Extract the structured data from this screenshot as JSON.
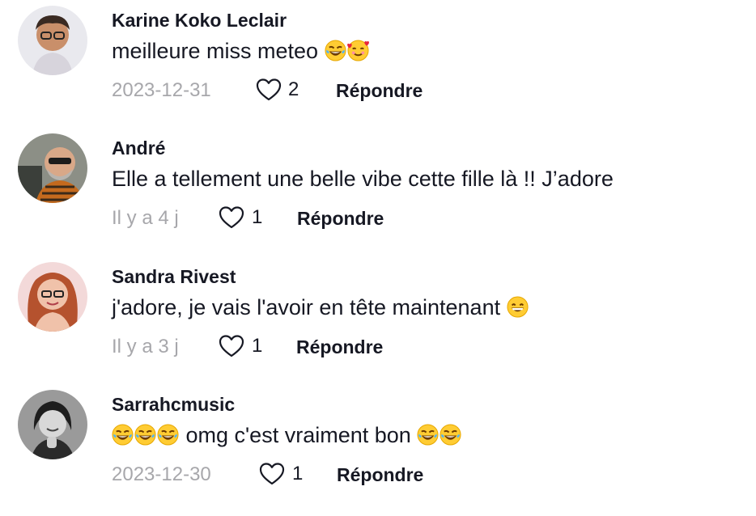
{
  "colors": {
    "text": "#161823",
    "muted": "#a7a7ab",
    "background": "#ffffff"
  },
  "comments": [
    {
      "username": "Karine Koko Leclair",
      "text_before": "meilleure miss meteo ",
      "text_after": "",
      "emojis_after": [
        "laughing-tears",
        "smiling-hearts"
      ],
      "date": "2023-12-31",
      "likes": "2",
      "reply_label": "Répondre"
    },
    {
      "username": "André",
      "text_before": "Elle a tellement une belle vibe cette fille là !! J’adore",
      "text_after": "",
      "date": "Il y a 4 j",
      "likes": "1",
      "reply_label": "Répondre"
    },
    {
      "username": "Sandra Rivest",
      "text_before": "j'adore, je vais l'avoir en tête maintenant ",
      "text_after": "",
      "emojis_after": [
        "grinning"
      ],
      "date": "Il y a 3 j",
      "likes": "1",
      "reply_label": "Répondre"
    },
    {
      "username": "Sarrahcmusic",
      "emojis_before": [
        "laughing-tears",
        "laughing-tears",
        "laughing-tears"
      ],
      "text_before": " omg c'est vraiment bon ",
      "text_after": "",
      "emojis_after": [
        "laughing-tears",
        "laughing-tears"
      ],
      "date": "2023-12-30",
      "likes": "1",
      "reply_label": "Répondre"
    }
  ]
}
